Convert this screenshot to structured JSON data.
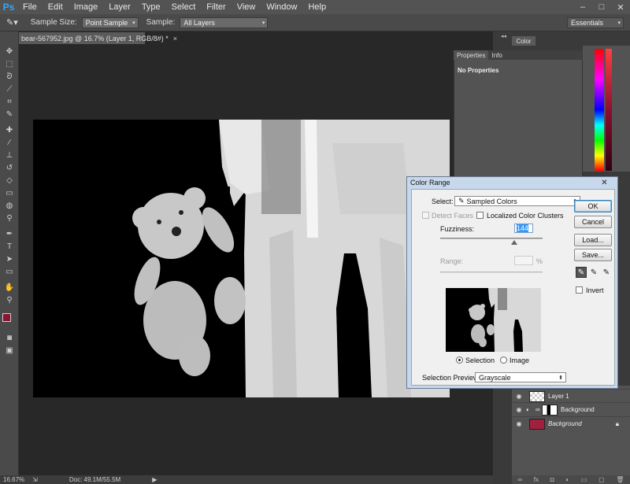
{
  "app": {
    "logo": "Ps"
  },
  "menu": [
    "File",
    "Edit",
    "Image",
    "Layer",
    "Type",
    "Select",
    "Filter",
    "View",
    "Window",
    "Help"
  ],
  "window_controls": [
    "–",
    "□",
    "✕"
  ],
  "options_bar": {
    "sample_size_label": "Sample Size:",
    "sample_size_value": "Point Sample",
    "sample_label": "Sample:",
    "sample_value": "All Layers",
    "workspace": "Essentials"
  },
  "document": {
    "tab_title": "bear-567952.jpg @ 16.7% (Layer 1, RGB/8#) *",
    "close": "×"
  },
  "status": {
    "zoom": "16.67%",
    "doc": "Doc: 49.1M/55.5M"
  },
  "panels": {
    "color_tab": "Color",
    "properties_tab": "Properties",
    "info_tab": "Info",
    "no_properties": "No Properties"
  },
  "layers": [
    {
      "name": "Layer 1",
      "italic": false
    },
    {
      "name": "Background",
      "italic": false
    },
    {
      "name": "Background",
      "italic": true
    }
  ],
  "dialog": {
    "title": "Color Range",
    "close": "✕",
    "select_label": "Select:",
    "select_value": "Sampled Colors",
    "detect_faces": "Detect Faces",
    "localized": "Localized Color Clusters",
    "fuzziness_label": "Fuzziness:",
    "fuzziness_value": "144",
    "range_label": "Range:",
    "range_unit": "%",
    "selection_radio": "Selection",
    "image_radio": "Image",
    "preview_label": "Selection Preview:",
    "preview_value": "Grayscale",
    "ok": "OK",
    "cancel": "Cancel",
    "load": "Load...",
    "save": "Save...",
    "invert": "Invert"
  },
  "colors": {
    "foreground": "#8a1530",
    "background": "#f0e0d0"
  }
}
